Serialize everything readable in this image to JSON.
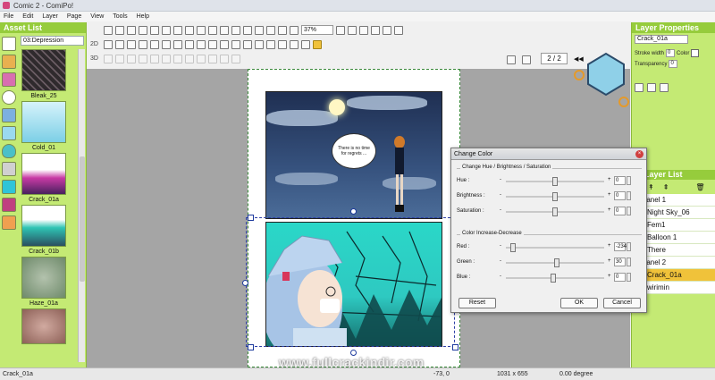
{
  "window": {
    "title": "Comic 2 - ComiPo!"
  },
  "menu": [
    "File",
    "Edit",
    "Layer",
    "Page",
    "View",
    "Tools",
    "Help"
  ],
  "asset_panel": {
    "header": "Asset List",
    "selected_category": "03:Depression",
    "items": [
      {
        "label": "Bleak_25",
        "color": "#2f2a2d"
      },
      {
        "label": "Cold_01",
        "color": "#aee4f2"
      },
      {
        "label": "Crack_01a",
        "color": "#c83aa5"
      },
      {
        "label": "Crack_01b",
        "color": "#2ec4b4"
      },
      {
        "label": "Haze_01a",
        "color": "#8a9e86"
      },
      {
        "label": "",
        "color": "#a77a71"
      }
    ]
  },
  "toolbar": {
    "row2_label": "2D",
    "row3_label": "3D",
    "zoom": "37%",
    "page_indicator": "2 / 2"
  },
  "canvas": {
    "speech_bubble": "There is no time for regrets ..."
  },
  "layer_properties": {
    "header": "Layer Properties",
    "name": "Crack_01a",
    "stroke_width_label": "Stroke width",
    "stroke_width": "0",
    "transparency_label": "Transparency",
    "transparency": "0",
    "color_label": "Color"
  },
  "layer_list": {
    "header": "Layer List",
    "items": [
      {
        "label": "Panel 1",
        "indent": 0,
        "selected": false
      },
      {
        "label": "Night Sky_06",
        "indent": 1,
        "selected": false
      },
      {
        "label": "Fem1",
        "indent": 1,
        "selected": false
      },
      {
        "label": "Balloon 1",
        "indent": 1,
        "selected": false
      },
      {
        "label": "There",
        "indent": 1,
        "selected": false
      },
      {
        "label": "Panel 2",
        "indent": 0,
        "selected": false
      },
      {
        "label": "Crack_01a",
        "indent": 1,
        "selected": true
      },
      {
        "label": "wirimin",
        "indent": 1,
        "selected": false
      }
    ]
  },
  "dialog": {
    "title": "Change Color",
    "group1_title": "Change Hue / Brightness / Saturation",
    "hue_label": "Hue :",
    "hue_value": "0",
    "hue_pos": 0.5,
    "brightness_label": "Brightness :",
    "brightness_value": "0",
    "brightness_pos": 0.5,
    "saturation_label": "Saturation :",
    "saturation_value": "0",
    "saturation_pos": 0.5,
    "group2_title": "Color Increase-Decrease",
    "red_label": "Red :",
    "red_value": "-234",
    "red_pos": 0.05,
    "green_label": "Green :",
    "green_value": "30",
    "green_pos": 0.52,
    "blue_label": "Blue :",
    "blue_value": "0",
    "blue_pos": 0.48,
    "reset_label": "Reset",
    "ok_label": "OK",
    "cancel_label": "Cancel"
  },
  "status": {
    "left": "Crack_01a",
    "coords": "-73, 0",
    "size": "1031 x 655",
    "rotation": "0.00 degree"
  },
  "watermark": "www.fullcrackindir.com"
}
